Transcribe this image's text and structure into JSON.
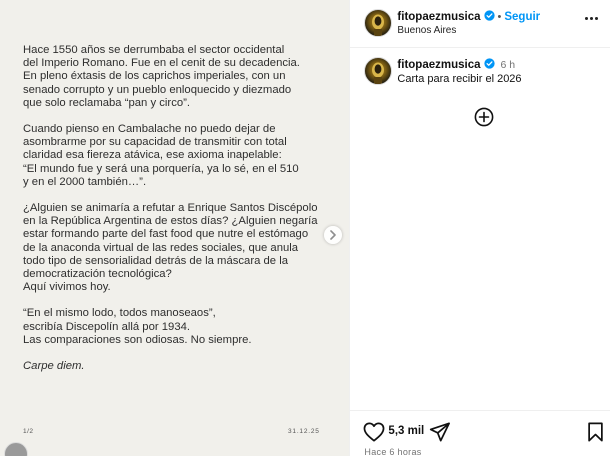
{
  "post_image": {
    "paragraphs": [
      {
        "lines": [
          "Hace 1550 años se derrumbaba el sector occidental",
          "del Imperio Romano. Fue en el cenit de su decadencia.",
          "En pleno éxtasis de los caprichos imperiales, con un",
          "senado corrupto y un pueblo enloquecido y diezmado",
          "que solo reclamaba “pan y circo”."
        ]
      },
      {
        "lines": [
          "Cuando pienso en Cambalache no puedo dejar de",
          "asombrarme por su capacidad de transmitir con total",
          "claridad esa fiereza atávica, ese axioma inapelable:",
          "“El mundo fue y será una porquería, ya lo sé, en el 510",
          "y en el 2000 también…”."
        ]
      },
      {
        "lines": [
          "¿Alguien se animaría a refutar a Enrique Santos Discépolo",
          "en la República Argentina de estos días? ¿Alguien negaría",
          "estar formando parte del fast food que nutre el estómago",
          "de la anaconda virtual de las redes sociales, que anula",
          "todo tipo de sensorialidad detrás de la máscara de la",
          "democratización tecnológica?",
          "Aquí vivimos hoy."
        ]
      },
      {
        "lines": [
          "“En el mismo lodo, todos manoseaos”,",
          "escribía Discepolín allá por 1934.",
          "Las comparaciones son odiosas. No siempre."
        ]
      },
      {
        "lines": [
          "Carpe diem."
        ]
      }
    ],
    "page_indicator": "1/2",
    "date_stamp": "31.12.25"
  },
  "header": {
    "username": "fitopaezmusica",
    "separator": "•",
    "follow_label": "Seguir",
    "location": "Buenos Aires"
  },
  "caption": {
    "username": "fitopaezmusica",
    "time": "6 h",
    "text": "Carta para recibir el 2026"
  },
  "actions": {
    "likes": "5,3 mil",
    "posted_ago": "Hace 6 horas"
  },
  "colors": {
    "accent": "#0095f6",
    "verified": "#0095f6",
    "image_bg": "#f1f0eb"
  },
  "icons": [
    "heart-icon",
    "share-icon",
    "bookmark-icon",
    "add-circle-icon",
    "chevron-right-icon",
    "verified-badge-icon",
    "more-icon"
  ]
}
